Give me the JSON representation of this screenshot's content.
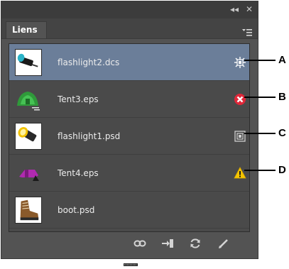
{
  "panel": {
    "tab_label": "Liens",
    "title_controls": {
      "collapse": "◂◂",
      "close": "✕"
    }
  },
  "files": [
    {
      "name": "flashlight2.dcs",
      "status": "modified-embedded",
      "selected": true
    },
    {
      "name": "Tent3.eps",
      "status": "missing",
      "selected": false
    },
    {
      "name": "flashlight1.psd",
      "status": "embedded",
      "selected": false
    },
    {
      "name": "Tent4.eps",
      "status": "modified",
      "selected": false
    },
    {
      "name": "boot.psd",
      "status": "none",
      "selected": false
    }
  ],
  "callouts": [
    "A",
    "B",
    "C",
    "D"
  ],
  "toolbar": [
    "relink-icon",
    "go-to-link-icon",
    "update-link-icon",
    "edit-original-icon"
  ],
  "colors": {
    "panel_bg": "#535353",
    "selected_row": "#6b7e99",
    "missing_red": "#e0283a",
    "warning_yellow": "#f5c400"
  }
}
